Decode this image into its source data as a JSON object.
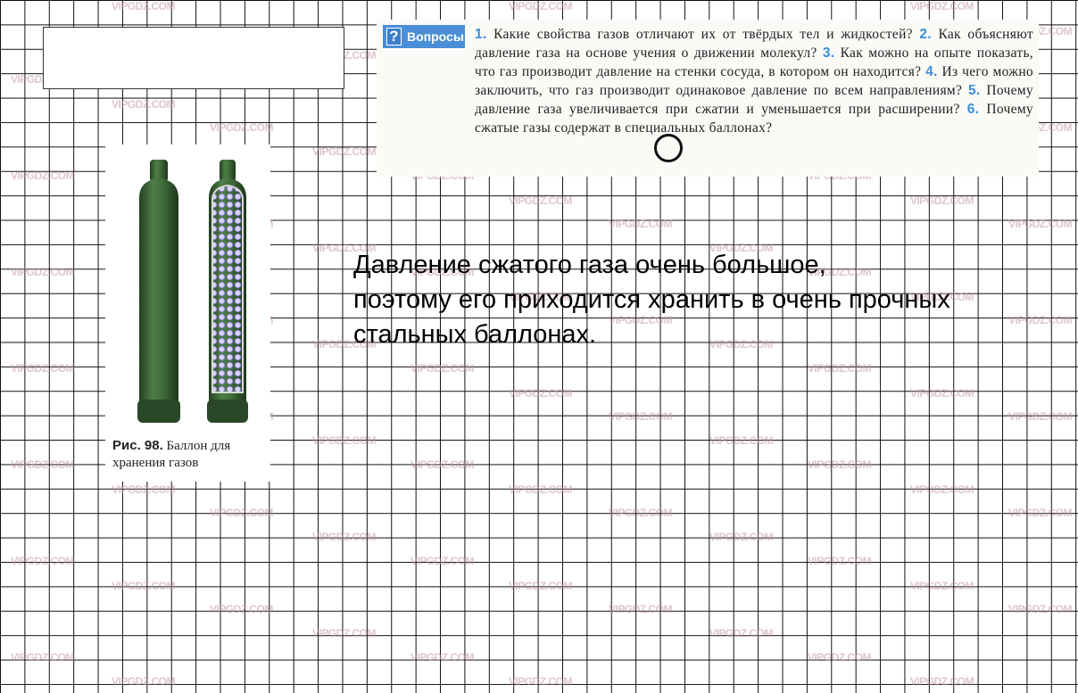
{
  "watermark": "VIPGDZ.COM",
  "questions": {
    "badge_label": "Вопросы",
    "badge_icon": "question-mark-icon",
    "items": [
      {
        "num": "1.",
        "text": "Какие свойства газов отличают их от твёрдых тел и жидкостей?"
      },
      {
        "num": "2.",
        "text": "Как объясняют давление газа на основе учения о движении молекул?"
      },
      {
        "num": "3.",
        "text": "Как можно на опыте показать, что газ производит давление на стенки сосуда, в котором он находится?"
      },
      {
        "num": "4.",
        "text": "Из чего можно заключить, что газ производит одинаковое давление по всем направлениям?"
      },
      {
        "num": "5.",
        "text": "Почему давление газа увеличивается при сжатии и уменьшается при расширении?"
      },
      {
        "num": "6.",
        "text": "Почему сжатые газы содержат в специальных баллонах?"
      }
    ]
  },
  "figure": {
    "caption_label": "Рис. 98.",
    "caption_text": "Баллон для хранения газов",
    "cylinder_color": "#3f6b3a",
    "gas_dots_color": "#9b8fd6"
  },
  "answer": {
    "lines": [
      "Давление сжатого газа очень большое,",
      "поэтому его приходится хранить в очень прочных",
      "стальных баллонах."
    ]
  }
}
